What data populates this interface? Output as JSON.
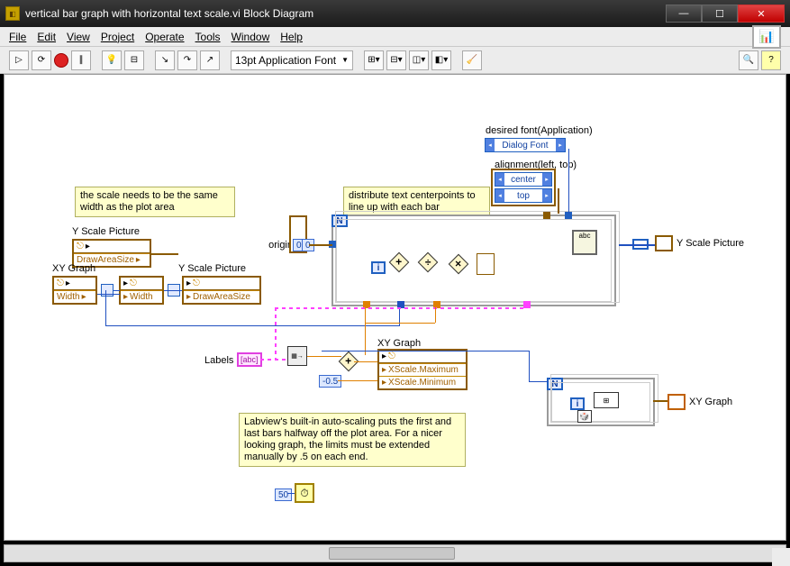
{
  "titlebar": {
    "title": "vertical bar graph with horizontal text scale.vi Block Diagram"
  },
  "menu": {
    "items": [
      "File",
      "Edit",
      "View",
      "Project",
      "Operate",
      "Tools",
      "Window",
      "Help"
    ]
  },
  "toolbar": {
    "font": "13pt Application Font"
  },
  "labels": {
    "desired_font": "desired font(Application)",
    "alignment": "alignment(left, top)",
    "origin": "origin",
    "labels": "Labels",
    "xy_graph": "XY Graph",
    "y_scale_picture": "Y Scale Picture",
    "y_scale_picture2": "Y Scale Picture",
    "y_scale_picture_out": "Y Scale Picture",
    "xy_graph2": "XY Graph",
    "xy_graph_out": "XY Graph"
  },
  "enums": {
    "dialog_font": "Dialog Font",
    "center": "center",
    "top": "top"
  },
  "props": {
    "draw_area": "DrawAreaSize",
    "width": "Width",
    "width2": "Width",
    "draw_area2": "DrawAreaSize",
    "xscale_max": "XScale.Maximum",
    "xscale_min": "XScale.Minimum"
  },
  "consts": {
    "origin_x": "0",
    "origin_y": "0",
    "half": "-0.5",
    "fifty": "50",
    "labels_abc": "[abc]"
  },
  "comments": {
    "scale_width": "the scale needs to be the same width as the plot area",
    "distribute": "distribute text centerpoints to line up with each bar",
    "autoscale": "Labview's built-in auto-scaling puts the first and last bars halfway off the plot area. For a nicer looking graph, the limits must be extended manually by .5 on each end."
  }
}
